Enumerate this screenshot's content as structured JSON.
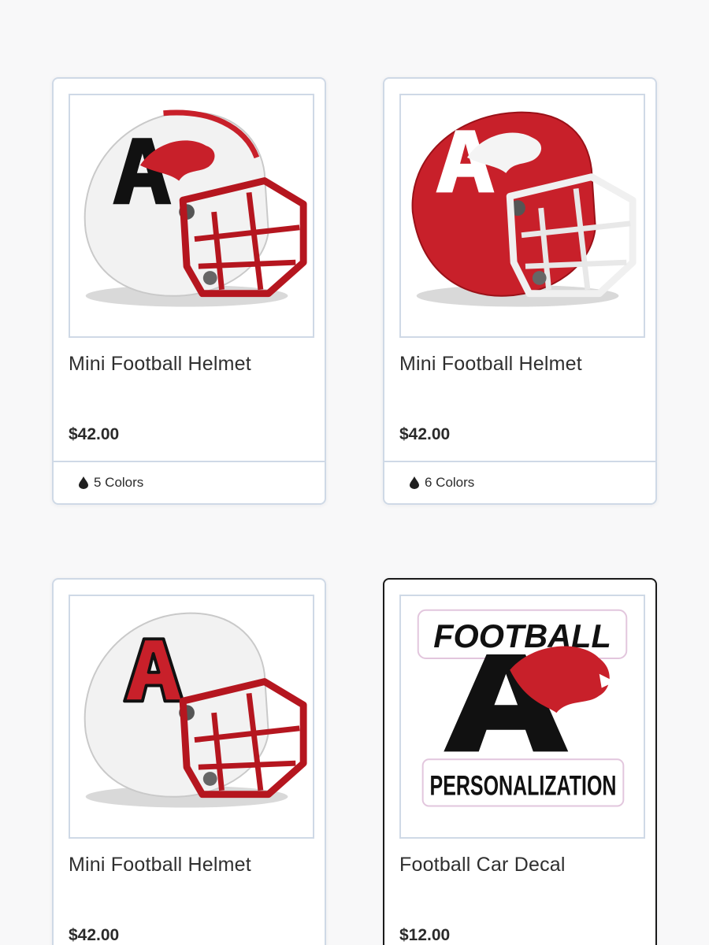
{
  "products": [
    {
      "title": "Mini Football Helmet",
      "price": "$42.00",
      "colors": "5 Colors",
      "image_icon": "white-helmet-lion-logo-icon"
    },
    {
      "title": "Mini Football Helmet",
      "price": "$42.00",
      "colors": "6 Colors",
      "image_icon": "red-helmet-lion-logo-icon"
    },
    {
      "title": "Mini Football Helmet",
      "price": "$42.00",
      "colors": "",
      "image_icon": "white-helmet-block-a-icon"
    },
    {
      "title": "Football Car Decal",
      "price": "$12.00",
      "colors": "",
      "image_icon": "football-decal-icon"
    }
  ],
  "decal": {
    "top_text": "FOOTBALL",
    "bottom_text": "PERSONALIZATION"
  },
  "theme": {
    "accent_red": "#c8202a",
    "border": "#cfd9e6",
    "background": "#f8f8f9"
  }
}
